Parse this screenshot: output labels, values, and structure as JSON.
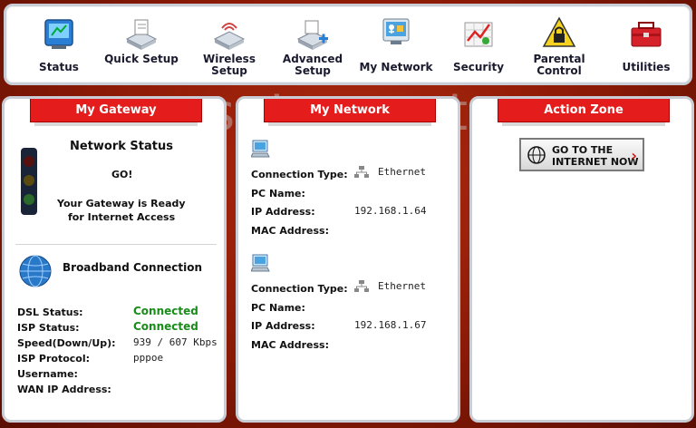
{
  "nav": [
    {
      "label": "Status",
      "icon": "status-icon"
    },
    {
      "label": "Quick Setup",
      "icon": "quick-setup-icon"
    },
    {
      "label": "Wireless Setup",
      "icon": "wireless-setup-icon"
    },
    {
      "label": "Advanced Setup",
      "icon": "advanced-setup-icon"
    },
    {
      "label": "My Network",
      "icon": "my-network-icon"
    },
    {
      "label": "Security",
      "icon": "security-icon"
    },
    {
      "label": "Parental Control",
      "icon": "parental-control-icon"
    },
    {
      "label": "Utilities",
      "icon": "utilities-icon"
    }
  ],
  "watermark": "setuprouter",
  "gateway": {
    "title": "My Gateway",
    "network_status_label": "Network Status",
    "signal": "GO!",
    "ready_line1": "Your Gateway is Ready",
    "ready_line2": "for Internet Access",
    "broadband_label": "Broadband Connection",
    "fields": [
      {
        "label": "DSL Status:",
        "value": "Connected"
      },
      {
        "label": "ISP Status:",
        "value": "Connected"
      },
      {
        "label": "Speed(Down/Up):",
        "value": "939 / 607 Kbps"
      },
      {
        "label": "ISP Protocol:",
        "value": "pppoe"
      },
      {
        "label": "Username:",
        "value": ""
      },
      {
        "label": "WAN IP Address:",
        "value": ""
      }
    ]
  },
  "network": {
    "title": "My Network",
    "devices": [
      {
        "connection_type_label": "Connection Type:",
        "connection_type": "Ethernet",
        "pc_name_label": "PC Name:",
        "ip_label": "IP Address:",
        "ip": "192.168.1.64",
        "mac_label": "MAC Address:"
      },
      {
        "connection_type_label": "Connection Type:",
        "connection_type": "Ethernet",
        "pc_name_label": "PC Name:",
        "ip_label": "IP Address:",
        "ip": "192.168.1.67",
        "mac_label": "MAC Address:"
      }
    ]
  },
  "action": {
    "title": "Action Zone",
    "internet_btn_line1": "GO TO THE",
    "internet_btn_line2": "INTERNET NOW"
  },
  "colors": {
    "header_red": "#e41c1c",
    "connected_green": "#1a8c1a",
    "background_red": "#8a1a06"
  }
}
